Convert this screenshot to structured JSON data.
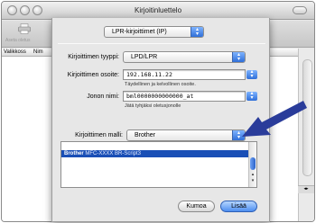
{
  "window": {
    "title": "Kirjoitinluettelo",
    "toolbar_label": "Aseta oletus",
    "columns": [
      "Valikkoss",
      "Nim"
    ]
  },
  "sheet": {
    "protocol_popup": "LPR-kirjoittimet (IP)",
    "printer_type_label": "Kirjoittimen tyyppi:",
    "printer_type_value": "LPD/LPR",
    "address_label": "Kirjoittimen osoite:",
    "address_value": "192.168.11.22",
    "address_hint": "Täydellinen ja kelvollinen osoite.",
    "queue_label": "Jonon nimi:",
    "queue_value": "bml0000000000000_at",
    "queue_hint": "Jätä tyhjäksi oletusjonolle",
    "model_label": "Kirjoittimen malli:",
    "model_value": "Brother",
    "model_list": [
      {
        "text": "Brother",
        "dim": "MFC-XXXX BR-Script3",
        "selected": true
      }
    ],
    "cancel_label": "Kumoa",
    "add_label": "Lisää"
  },
  "colors": {
    "selection": "#1a4fb6",
    "default_button": "#4d8ef0",
    "annotation_arrow": "#2a3c9a"
  }
}
